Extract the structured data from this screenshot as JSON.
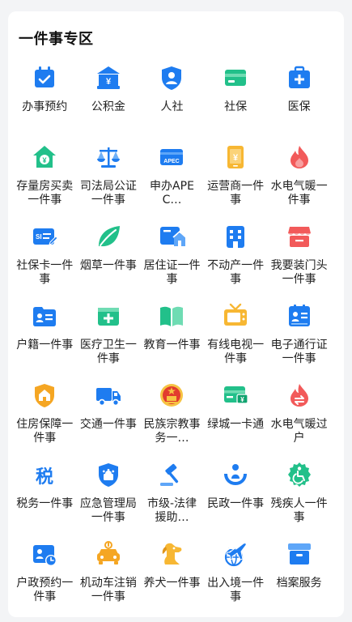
{
  "section": {
    "title": "一件事专区"
  },
  "colors": {
    "blue": "#1e7cf0",
    "green": "#22c08a",
    "orange": "#f5a623",
    "red": "#f25a5a",
    "yellow": "#f7b733"
  },
  "items": [
    {
      "label": "办事预约",
      "icon": "calendar-check-icon"
    },
    {
      "label": "公积金",
      "icon": "bank-house-icon"
    },
    {
      "label": "人社",
      "icon": "shield-person-icon"
    },
    {
      "label": "社保",
      "icon": "card-icon"
    },
    {
      "label": "医保",
      "icon": "medical-kit-icon"
    },
    {
      "label": "存量房买卖一件事",
      "icon": "house-yuan-icon"
    },
    {
      "label": "司法局公证一件事",
      "icon": "scales-icon"
    },
    {
      "label": "申办APEC…",
      "icon": "apec-card-icon"
    },
    {
      "label": "运营商一件事",
      "icon": "phone-yuan-icon"
    },
    {
      "label": "水电气暖一件事",
      "icon": "flame-icon"
    },
    {
      "label": "社保卡一件事",
      "icon": "sb-card-icon"
    },
    {
      "label": "烟草一件事",
      "icon": "leaf-icon"
    },
    {
      "label": "居住证一件事",
      "icon": "residence-card-icon"
    },
    {
      "label": "不动产一件事",
      "icon": "building-icon"
    },
    {
      "label": "我要装门头一件事",
      "icon": "storefront-icon"
    },
    {
      "label": "户籍一件事",
      "icon": "id-folder-icon"
    },
    {
      "label": "医疗卫生一件事",
      "icon": "medical-box-icon"
    },
    {
      "label": "教育一件事",
      "icon": "book-icon"
    },
    {
      "label": "有线电视一件事",
      "icon": "tv-icon"
    },
    {
      "label": "电子通行证一件事",
      "icon": "pass-card-icon"
    },
    {
      "label": "住房保障一件事",
      "icon": "house-shield-icon"
    },
    {
      "label": "交通一件事",
      "icon": "truck-icon"
    },
    {
      "label": "民族宗教事务一…",
      "icon": "national-emblem-icon"
    },
    {
      "label": "绿城一卡通",
      "icon": "green-card-icon"
    },
    {
      "label": "水电气暖过户",
      "icon": "flame-transfer-icon"
    },
    {
      "label": "税务一件事",
      "icon": "tax-icon"
    },
    {
      "label": "应急管理局一件事",
      "icon": "emergency-shield-icon"
    },
    {
      "label": "市级-法律援助…",
      "icon": "gavel-icon"
    },
    {
      "label": "民政一件事",
      "icon": "hands-person-icon"
    },
    {
      "label": "残疾人一件事",
      "icon": "disability-icon"
    },
    {
      "label": "户政预约一件事",
      "icon": "id-clock-icon"
    },
    {
      "label": "机动车注销一件事",
      "icon": "car-icon"
    },
    {
      "label": "养犬一件事",
      "icon": "dog-icon"
    },
    {
      "label": "出入境一件事",
      "icon": "plane-globe-icon"
    },
    {
      "label": "档案服务",
      "icon": "archive-box-icon"
    }
  ]
}
